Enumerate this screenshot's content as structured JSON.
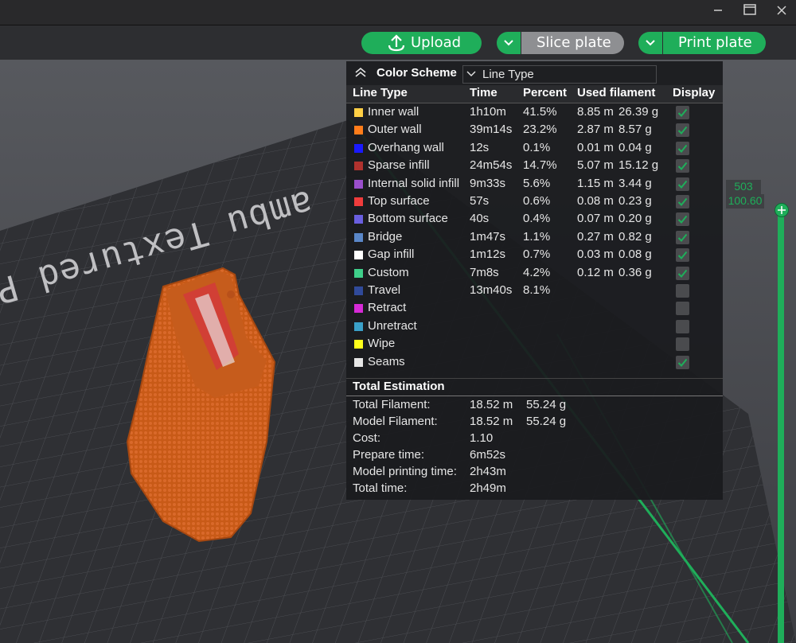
{
  "window": {
    "minimize_icon": "minimize-icon",
    "maximize_icon": "maximize-icon",
    "close_icon": "close-icon"
  },
  "toolbar": {
    "upload_label": "Upload",
    "slice_label": "Slice plate",
    "print_label": "Print plate",
    "accent": "#1fae5a"
  },
  "scene": {
    "plate_text": "ambu Textured PEI",
    "plate_text_left": "PEI"
  },
  "panel": {
    "color_scheme_label": "Color Scheme",
    "color_scheme_value": "Line Type",
    "columns": {
      "type": "Line Type",
      "time": "Time",
      "percent": "Percent",
      "filament": "Used filament",
      "display": "Display"
    },
    "rows": [
      {
        "name": "Inner wall",
        "color": "#ffcf45",
        "time": "1h10m",
        "percent": "41.5%",
        "length": "8.85 m",
        "weight": "26.39 g",
        "display": true
      },
      {
        "name": "Outer wall",
        "color": "#ff7d1a",
        "time": "39m14s",
        "percent": "23.2%",
        "length": "2.87 m",
        "weight": "8.57 g",
        "display": true
      },
      {
        "name": "Overhang wall",
        "color": "#1a1aff",
        "time": "12s",
        "percent": "0.1%",
        "length": "0.01 m",
        "weight": "0.04 g",
        "display": true
      },
      {
        "name": "Sparse infill",
        "color": "#b0322e",
        "time": "24m54s",
        "percent": "14.7%",
        "length": "5.07 m",
        "weight": "15.12 g",
        "display": true
      },
      {
        "name": "Internal solid infill",
        "color": "#9b4fcc",
        "time": "9m33s",
        "percent": "5.6%",
        "length": "1.15 m",
        "weight": "3.44 g",
        "display": true
      },
      {
        "name": "Top surface",
        "color": "#f03c3c",
        "time": "57s",
        "percent": "0.6%",
        "length": "0.08 m",
        "weight": "0.23 g",
        "display": true
      },
      {
        "name": "Bottom surface",
        "color": "#6a5fe0",
        "time": "40s",
        "percent": "0.4%",
        "length": "0.07 m",
        "weight": "0.20 g",
        "display": true
      },
      {
        "name": "Bridge",
        "color": "#5a87c8",
        "time": "1m47s",
        "percent": "1.1%",
        "length": "0.27 m",
        "weight": "0.82 g",
        "display": true
      },
      {
        "name": "Gap infill",
        "color": "#ffffff",
        "time": "1m12s",
        "percent": "0.7%",
        "length": "0.03 m",
        "weight": "0.08 g",
        "display": true
      },
      {
        "name": "Custom",
        "color": "#3fcf8a",
        "time": "7m8s",
        "percent": "4.2%",
        "length": "0.12 m",
        "weight": "0.36 g",
        "display": true
      },
      {
        "name": "Travel",
        "color": "#304a9a",
        "time": "13m40s",
        "percent": "8.1%",
        "length": "",
        "weight": "",
        "display": false
      },
      {
        "name": "Retract",
        "color": "#d62ad6",
        "time": "",
        "percent": "",
        "length": "",
        "weight": "",
        "display": false
      },
      {
        "name": "Unretract",
        "color": "#3aa0c8",
        "time": "",
        "percent": "",
        "length": "",
        "weight": "",
        "display": false
      },
      {
        "name": "Wipe",
        "color": "#ffff1a",
        "time": "",
        "percent": "",
        "length": "",
        "weight": "",
        "display": false
      },
      {
        "name": "Seams",
        "color": "#e6e6e6",
        "time": "",
        "percent": "",
        "length": "",
        "weight": "",
        "display": true
      }
    ],
    "total_title": "Total Estimation",
    "totals": [
      {
        "label": "Total Filament:",
        "v1": "18.52 m",
        "v2": "55.24 g"
      },
      {
        "label": "Model Filament:",
        "v1": "18.52 m",
        "v2": "55.24 g"
      },
      {
        "label": "Cost:",
        "v1": "1.10",
        "v2": ""
      },
      {
        "label": "Prepare time:",
        "v1": "6m52s",
        "v2": ""
      },
      {
        "label": "Model printing time:",
        "v1": "2h43m",
        "v2": ""
      },
      {
        "label": "Total time:",
        "v1": "2h49m",
        "v2": ""
      }
    ]
  },
  "slider": {
    "layer": "503",
    "height": "100.60"
  }
}
